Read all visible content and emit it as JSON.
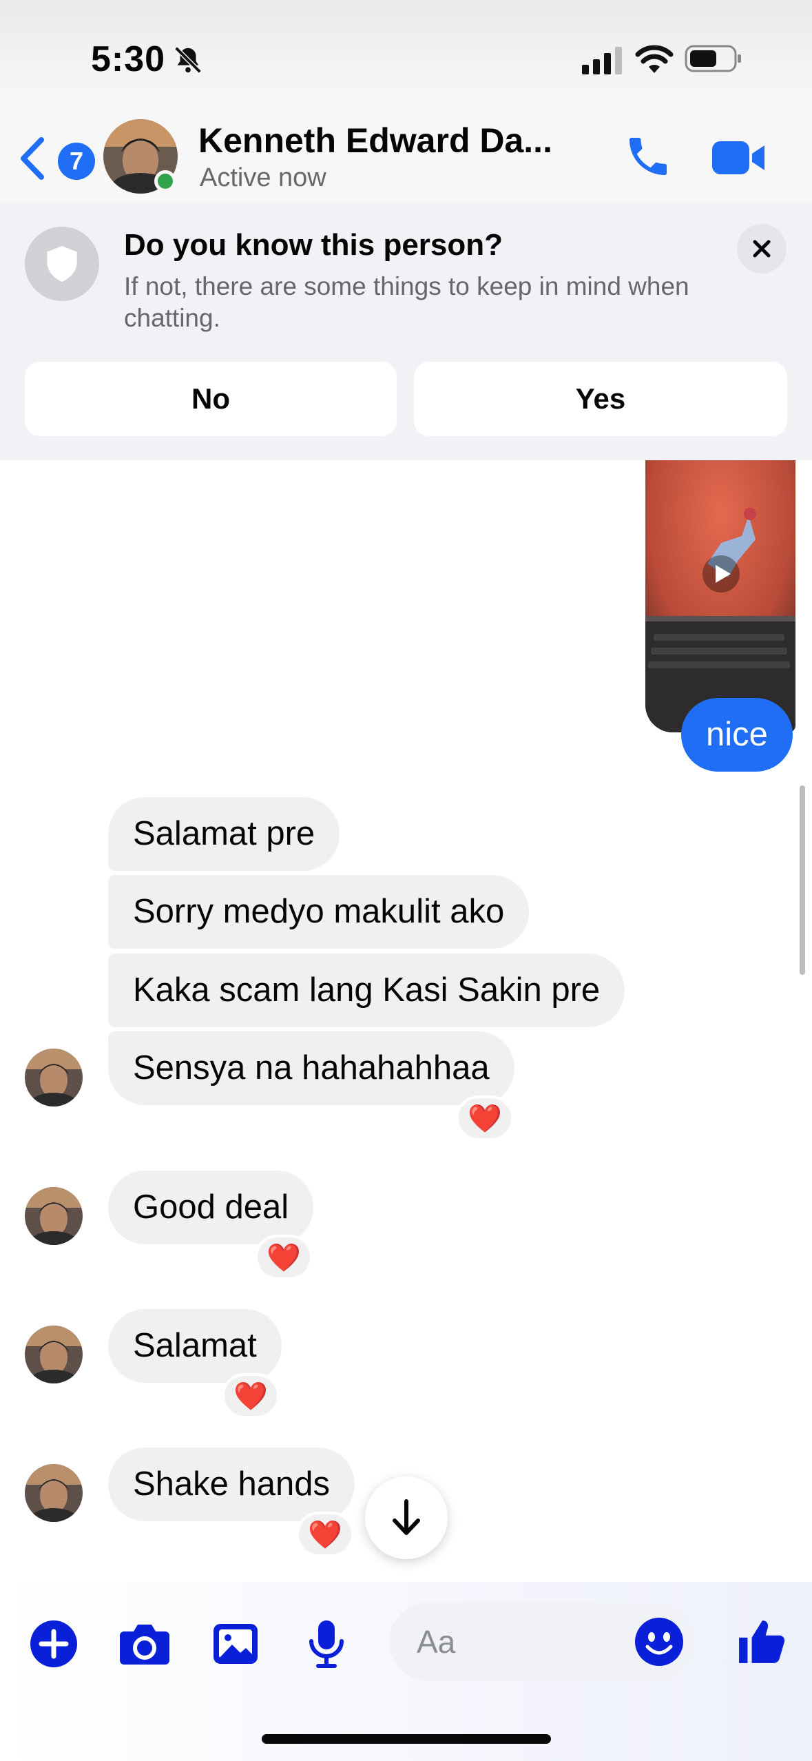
{
  "status_bar": {
    "time": "5:30",
    "icons": [
      "bell-slash-icon",
      "signal-icon",
      "wifi-icon",
      "battery-icon"
    ]
  },
  "header": {
    "back_count": "7",
    "contact_name": "Kenneth Edward Da...",
    "contact_status": "Active now",
    "icons": [
      "chevron-left-icon",
      "phone-icon",
      "video-camera-icon"
    ],
    "accent_color": "#1f6ef5",
    "online_color": "#31a24c"
  },
  "safety_banner": {
    "title": "Do you know this person?",
    "text": "If not, there are some things to keep in mind when chatting.",
    "no_label": "No",
    "yes_label": "Yes",
    "icons": [
      "shield-icon",
      "close-icon"
    ]
  },
  "messages": {
    "outgoing": [
      {
        "type": "video",
        "icon": "play-icon"
      },
      {
        "type": "text",
        "text": "nice"
      }
    ],
    "incoming": [
      {
        "text": "Salamat pre",
        "reaction": ""
      },
      {
        "text": "Sorry medyo makulit ako",
        "reaction": ""
      },
      {
        "text": "Kaka scam lang Kasi Sakin pre",
        "reaction": ""
      },
      {
        "text": "Sensya na hahahahhaa",
        "reaction": "❤️"
      },
      {
        "text": "Good deal",
        "reaction": "❤️"
      },
      {
        "text": "Salamat",
        "reaction": "❤️"
      },
      {
        "text": "Shake hands",
        "reaction": "❤️"
      }
    ]
  },
  "composer": {
    "placeholder": "Aa",
    "icons": [
      "plus-circle-icon",
      "camera-icon",
      "gallery-icon",
      "microphone-icon",
      "emoji-icon",
      "thumbs-up-icon"
    ],
    "icon_color": "#0a1fd8"
  }
}
